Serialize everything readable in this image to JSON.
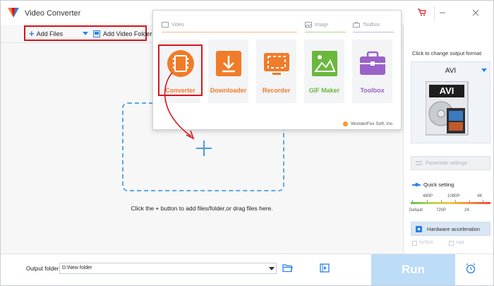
{
  "app": {
    "title": "Video Converter"
  },
  "window_controls": [
    "cart-icon",
    "minimize-icon",
    "close-icon"
  ],
  "toolbar": {
    "add_files_label": "Add Files",
    "add_folder_label": "Add Video Folder"
  },
  "main": {
    "hint": "Click the + button to add files/folder,or drag files here."
  },
  "popup": {
    "sections": {
      "video": "Video",
      "image": "Image",
      "toolbox": "Toolbox"
    },
    "tiles": [
      {
        "label": "Converter",
        "color": "#f07c2a"
      },
      {
        "label": "Downloader",
        "color": "#f07c2a"
      },
      {
        "label": "Recorder",
        "color": "#f07c2a"
      },
      {
        "label": "GIF Maker",
        "color": "#6ab83c"
      },
      {
        "label": "Toolbox",
        "color": "#9a62c8"
      }
    ],
    "credit": "WonderFox Soft, Inc."
  },
  "right_panel": {
    "output_label": "Click to change output format:",
    "format": "AVI",
    "format_badge": "AVI",
    "parameter_label": "Parameter settings",
    "quick_label": "Quick setting",
    "quality_top": [
      "480P",
      "1080P",
      "4K"
    ],
    "quality_bottom": [
      "Default",
      "720P",
      "2K"
    ],
    "hw_label": "Hardware acceleration",
    "vendors": [
      "NVIDIA",
      "Intel"
    ]
  },
  "bottom": {
    "output_label": "Output folder:",
    "output_value": "D:\\New folder",
    "run_label": "Run"
  },
  "colors": {
    "accent": "#2a82e4",
    "highlight": "#d8141b",
    "orange": "#f07c2a",
    "green": "#6ab83c",
    "purple": "#9a62c8"
  }
}
